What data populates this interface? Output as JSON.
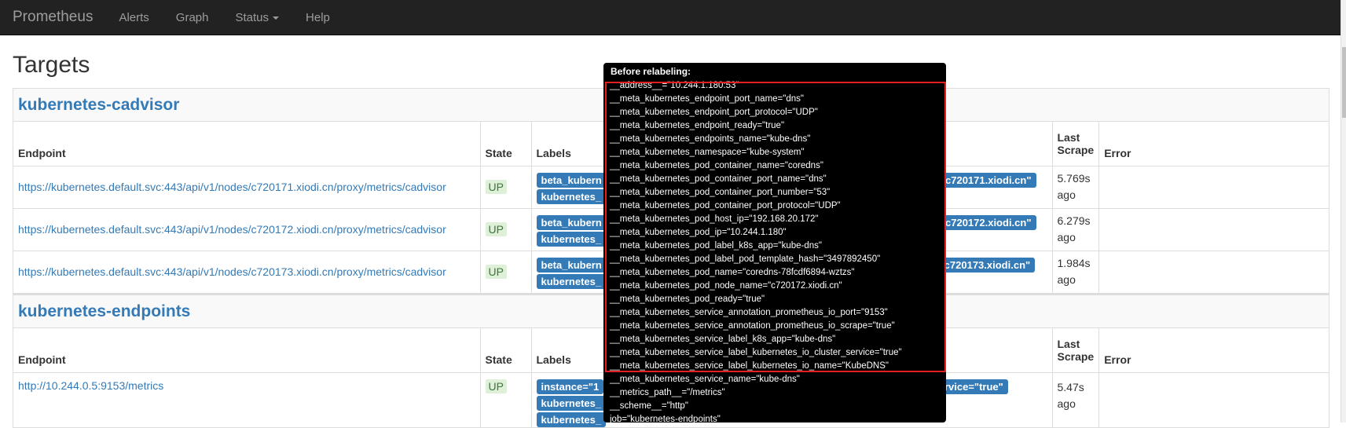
{
  "nav": {
    "brand": "Prometheus",
    "items": [
      "Alerts",
      "Graph",
      "Status",
      "Help"
    ]
  },
  "page_title": "Targets",
  "headers": {
    "endpoint": "Endpoint",
    "state": "State",
    "labels": "Labels",
    "last_scrape_1": "Last",
    "last_scrape_2": "Scrape",
    "error": "Error"
  },
  "jobs": [
    {
      "name": "kubernetes-cadvisor",
      "rows": [
        {
          "endpoint": "https://kubernetes.default.svc:443/api/v1/nodes/c720171.xiodi.cn/proxy/metrics/cadvisor",
          "state": "UP",
          "labels": [
            "beta_kubern",
            "kubernetes_",
            "instance=\"c720171.xiodi.cn\""
          ],
          "last_1": "5.769s",
          "last_2": "ago"
        },
        {
          "endpoint": "https://kubernetes.default.svc:443/api/v1/nodes/c720172.xiodi.cn/proxy/metrics/cadvisor",
          "state": "UP",
          "labels": [
            "beta_kubern",
            "kubernetes_",
            "instance=\"c720172.xiodi.cn\""
          ],
          "last_1": "6.279s",
          "last_2": "ago"
        },
        {
          "endpoint": "https://kubernetes.default.svc:443/api/v1/nodes/c720173.xiodi.cn/proxy/metrics/cadvisor",
          "state": "UP",
          "labels": [
            "beta_kubern",
            "kubernetes_",
            "\"c720173.xiodi.cn\""
          ],
          "last_1": "1.984s",
          "last_2": "ago"
        }
      ]
    },
    {
      "name": "kubernetes-endpoints",
      "rows": [
        {
          "endpoint": "http://10.244.0.5:9153/metrics",
          "state": "UP",
          "labels": [
            "instance=\"1",
            "kubernetes_",
            "kubernetes_",
            "service=\"true\""
          ],
          "last_1": "5.47s",
          "last_2": "ago"
        }
      ]
    }
  ],
  "tooltip": {
    "title": "Before relabeling:",
    "lines": [
      "__address__=\"10.244.1.180:53\"",
      "__meta_kubernetes_endpoint_port_name=\"dns\"",
      "__meta_kubernetes_endpoint_port_protocol=\"UDP\"",
      "__meta_kubernetes_endpoint_ready=\"true\"",
      "__meta_kubernetes_endpoints_name=\"kube-dns\"",
      "__meta_kubernetes_namespace=\"kube-system\"",
      "__meta_kubernetes_pod_container_name=\"coredns\"",
      "__meta_kubernetes_pod_container_port_name=\"dns\"",
      "__meta_kubernetes_pod_container_port_number=\"53\"",
      "__meta_kubernetes_pod_container_port_protocol=\"UDP\"",
      "__meta_kubernetes_pod_host_ip=\"192.168.20.172\"",
      "__meta_kubernetes_pod_ip=\"10.244.1.180\"",
      "__meta_kubernetes_pod_label_k8s_app=\"kube-dns\"",
      "__meta_kubernetes_pod_label_pod_template_hash=\"3497892450\"",
      "__meta_kubernetes_pod_name=\"coredns-78fcdf6894-wztzs\"",
      "__meta_kubernetes_pod_node_name=\"c720172.xiodi.cn\"",
      "__meta_kubernetes_pod_ready=\"true\"",
      "__meta_kubernetes_service_annotation_prometheus_io_port=\"9153\"",
      "__meta_kubernetes_service_annotation_prometheus_io_scrape=\"true\"",
      "__meta_kubernetes_service_label_k8s_app=\"kube-dns\"",
      "__meta_kubernetes_service_label_kubernetes_io_cluster_service=\"true\"",
      "__meta_kubernetes_service_label_kubernetes_io_name=\"KubeDNS\"",
      "__meta_kubernetes_service_name=\"kube-dns\"",
      "__metrics_path__=\"/metrics\"",
      "__scheme__=\"http\"",
      "job=\"kubernetes-endpoints\""
    ]
  }
}
